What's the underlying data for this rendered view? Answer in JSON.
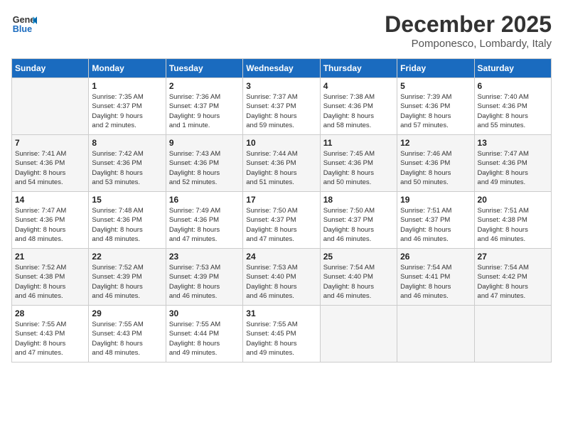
{
  "header": {
    "logo_line1": "General",
    "logo_line2": "Blue",
    "month": "December 2025",
    "location": "Pomponesco, Lombardy, Italy"
  },
  "weekdays": [
    "Sunday",
    "Monday",
    "Tuesday",
    "Wednesday",
    "Thursday",
    "Friday",
    "Saturday"
  ],
  "weeks": [
    [
      {
        "day": "",
        "info": ""
      },
      {
        "day": "1",
        "info": "Sunrise: 7:35 AM\nSunset: 4:37 PM\nDaylight: 9 hours\nand 2 minutes."
      },
      {
        "day": "2",
        "info": "Sunrise: 7:36 AM\nSunset: 4:37 PM\nDaylight: 9 hours\nand 1 minute."
      },
      {
        "day": "3",
        "info": "Sunrise: 7:37 AM\nSunset: 4:37 PM\nDaylight: 8 hours\nand 59 minutes."
      },
      {
        "day": "4",
        "info": "Sunrise: 7:38 AM\nSunset: 4:36 PM\nDaylight: 8 hours\nand 58 minutes."
      },
      {
        "day": "5",
        "info": "Sunrise: 7:39 AM\nSunset: 4:36 PM\nDaylight: 8 hours\nand 57 minutes."
      },
      {
        "day": "6",
        "info": "Sunrise: 7:40 AM\nSunset: 4:36 PM\nDaylight: 8 hours\nand 55 minutes."
      }
    ],
    [
      {
        "day": "7",
        "info": "Sunrise: 7:41 AM\nSunset: 4:36 PM\nDaylight: 8 hours\nand 54 minutes."
      },
      {
        "day": "8",
        "info": "Sunrise: 7:42 AM\nSunset: 4:36 PM\nDaylight: 8 hours\nand 53 minutes."
      },
      {
        "day": "9",
        "info": "Sunrise: 7:43 AM\nSunset: 4:36 PM\nDaylight: 8 hours\nand 52 minutes."
      },
      {
        "day": "10",
        "info": "Sunrise: 7:44 AM\nSunset: 4:36 PM\nDaylight: 8 hours\nand 51 minutes."
      },
      {
        "day": "11",
        "info": "Sunrise: 7:45 AM\nSunset: 4:36 PM\nDaylight: 8 hours\nand 50 minutes."
      },
      {
        "day": "12",
        "info": "Sunrise: 7:46 AM\nSunset: 4:36 PM\nDaylight: 8 hours\nand 50 minutes."
      },
      {
        "day": "13",
        "info": "Sunrise: 7:47 AM\nSunset: 4:36 PM\nDaylight: 8 hours\nand 49 minutes."
      }
    ],
    [
      {
        "day": "14",
        "info": "Sunrise: 7:47 AM\nSunset: 4:36 PM\nDaylight: 8 hours\nand 48 minutes."
      },
      {
        "day": "15",
        "info": "Sunrise: 7:48 AM\nSunset: 4:36 PM\nDaylight: 8 hours\nand 48 minutes."
      },
      {
        "day": "16",
        "info": "Sunrise: 7:49 AM\nSunset: 4:36 PM\nDaylight: 8 hours\nand 47 minutes."
      },
      {
        "day": "17",
        "info": "Sunrise: 7:50 AM\nSunset: 4:37 PM\nDaylight: 8 hours\nand 47 minutes."
      },
      {
        "day": "18",
        "info": "Sunrise: 7:50 AM\nSunset: 4:37 PM\nDaylight: 8 hours\nand 46 minutes."
      },
      {
        "day": "19",
        "info": "Sunrise: 7:51 AM\nSunset: 4:37 PM\nDaylight: 8 hours\nand 46 minutes."
      },
      {
        "day": "20",
        "info": "Sunrise: 7:51 AM\nSunset: 4:38 PM\nDaylight: 8 hours\nand 46 minutes."
      }
    ],
    [
      {
        "day": "21",
        "info": "Sunrise: 7:52 AM\nSunset: 4:38 PM\nDaylight: 8 hours\nand 46 minutes."
      },
      {
        "day": "22",
        "info": "Sunrise: 7:52 AM\nSunset: 4:39 PM\nDaylight: 8 hours\nand 46 minutes."
      },
      {
        "day": "23",
        "info": "Sunrise: 7:53 AM\nSunset: 4:39 PM\nDaylight: 8 hours\nand 46 minutes."
      },
      {
        "day": "24",
        "info": "Sunrise: 7:53 AM\nSunset: 4:40 PM\nDaylight: 8 hours\nand 46 minutes."
      },
      {
        "day": "25",
        "info": "Sunrise: 7:54 AM\nSunset: 4:40 PM\nDaylight: 8 hours\nand 46 minutes."
      },
      {
        "day": "26",
        "info": "Sunrise: 7:54 AM\nSunset: 4:41 PM\nDaylight: 8 hours\nand 46 minutes."
      },
      {
        "day": "27",
        "info": "Sunrise: 7:54 AM\nSunset: 4:42 PM\nDaylight: 8 hours\nand 47 minutes."
      }
    ],
    [
      {
        "day": "28",
        "info": "Sunrise: 7:55 AM\nSunset: 4:43 PM\nDaylight: 8 hours\nand 47 minutes."
      },
      {
        "day": "29",
        "info": "Sunrise: 7:55 AM\nSunset: 4:43 PM\nDaylight: 8 hours\nand 48 minutes."
      },
      {
        "day": "30",
        "info": "Sunrise: 7:55 AM\nSunset: 4:44 PM\nDaylight: 8 hours\nand 49 minutes."
      },
      {
        "day": "31",
        "info": "Sunrise: 7:55 AM\nSunset: 4:45 PM\nDaylight: 8 hours\nand 49 minutes."
      },
      {
        "day": "",
        "info": ""
      },
      {
        "day": "",
        "info": ""
      },
      {
        "day": "",
        "info": ""
      }
    ]
  ]
}
